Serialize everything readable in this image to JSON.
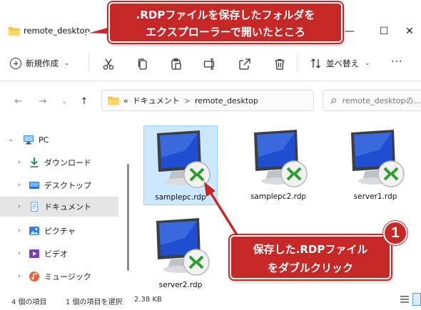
{
  "window": {
    "title": "remote_desktop",
    "controls": {
      "minimize": "—",
      "maximize": "☐",
      "close": "✕"
    }
  },
  "callouts": {
    "top": {
      "line1": ".RDPファイルを保存したフォルダを",
      "line2": "エクスプローラーで開いたところ"
    },
    "bottom": {
      "line1": "保存した.RDPファイル",
      "line2": "をダブルクリック"
    },
    "step_number": "1"
  },
  "toolbar": {
    "new_label": "新規作成",
    "sort_label": "並べ替え",
    "more_label": "···",
    "icons": [
      "cut-icon",
      "copy-icon",
      "paste-icon",
      "rename-icon",
      "share-icon",
      "delete-icon"
    ]
  },
  "address": {
    "prefix": "«",
    "segments": [
      "ドキュメント",
      "remote_desktop"
    ],
    "separator": ">",
    "search_placeholder": "remote_desktopの..."
  },
  "nav": {
    "items": [
      {
        "label": "PC",
        "icon": "pc-icon",
        "expanded": true
      },
      {
        "label": "ダウンロード",
        "icon": "download-icon"
      },
      {
        "label": "デスクトップ",
        "icon": "desktop-icon"
      },
      {
        "label": "ドキュメント",
        "icon": "documents-icon",
        "selected": true
      },
      {
        "label": "ピクチャ",
        "icon": "pictures-icon"
      },
      {
        "label": "ビデオ",
        "icon": "videos-icon"
      },
      {
        "label": "ミュージック",
        "icon": "music-icon"
      }
    ]
  },
  "files": [
    {
      "name": "samplepc.rdp",
      "selected": true
    },
    {
      "name": "samplepc2.rdp",
      "selected": false
    },
    {
      "name": "server1.rdp",
      "selected": false
    },
    {
      "name": "server2.rdp",
      "selected": false
    }
  ],
  "status": {
    "item_count": "4 個の項目",
    "selection": "1 個の項目を選択",
    "size": "2.38 KB"
  },
  "colors": {
    "callout": "#c62828",
    "selection_bg": "#cce8ff",
    "selection_border": "#99d1ff",
    "rdp_arrow": "#2e9e2e",
    "monitor_screen": "#1f4fd0"
  }
}
